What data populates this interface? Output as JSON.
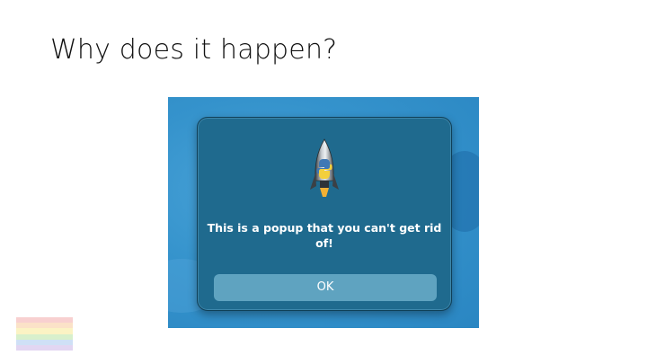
{
  "slide": {
    "title": "Why does it happen?"
  },
  "dialog": {
    "message": "This is a popup that you can't get rid of!",
    "ok_label": "OK",
    "icon": "python-rocket-icon"
  },
  "logo": {
    "icon": "rainbow-stripes-logo",
    "stripe_colors": [
      "#f8d0d0",
      "#fbe2c8",
      "#fbf3c4",
      "#d8f0cc",
      "#cfe0f6",
      "#e2d6f2"
    ]
  },
  "colors": {
    "backdrop": "#3593cc",
    "dialog_bg": "#1f6a8e",
    "button_bg": "#5fa3c0",
    "text": "#ffffff"
  }
}
